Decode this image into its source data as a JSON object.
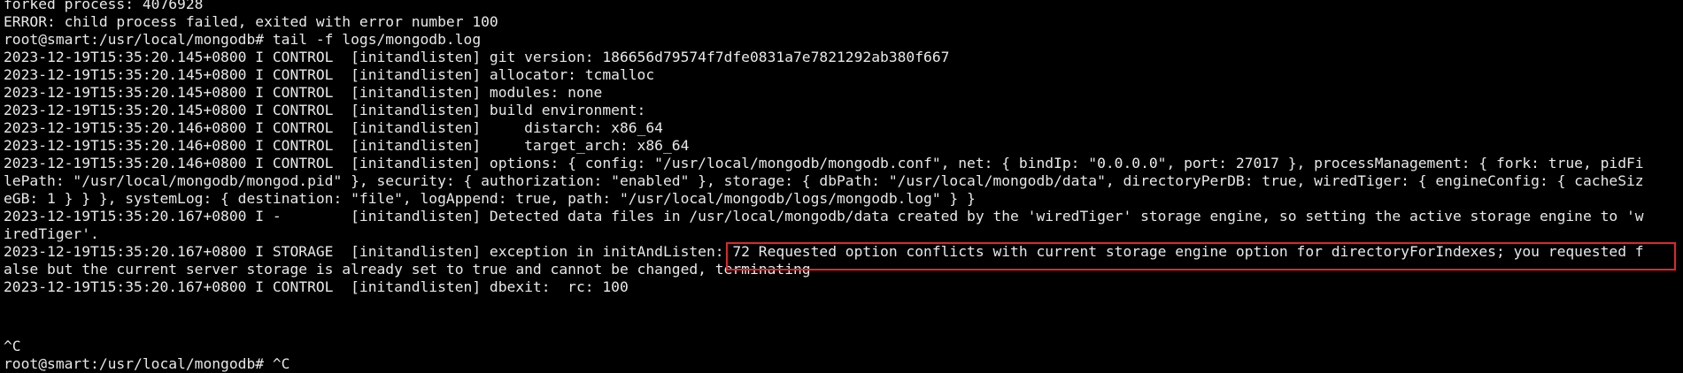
{
  "terminal": {
    "lines": [
      "forked process: 4076928",
      "ERROR: child process failed, exited with error number 100",
      "root@smart:/usr/local/mongodb# tail -f logs/mongodb.log",
      "2023-12-19T15:35:20.145+0800 I CONTROL  [initandlisten] git version: 186656d79574f7dfe0831a7e7821292ab380f667",
      "2023-12-19T15:35:20.145+0800 I CONTROL  [initandlisten] allocator: tcmalloc",
      "2023-12-19T15:35:20.145+0800 I CONTROL  [initandlisten] modules: none",
      "2023-12-19T15:35:20.145+0800 I CONTROL  [initandlisten] build environment:",
      "2023-12-19T15:35:20.146+0800 I CONTROL  [initandlisten]     distarch: x86_64",
      "2023-12-19T15:35:20.146+0800 I CONTROL  [initandlisten]     target_arch: x86_64",
      "2023-12-19T15:35:20.146+0800 I CONTROL  [initandlisten] options: { config: \"/usr/local/mongodb/mongodb.conf\", net: { bindIp: \"0.0.0.0\", port: 27017 }, processManagement: { fork: true, pidFi",
      "lePath: \"/usr/local/mongodb/mongod.pid\" }, security: { authorization: \"enabled\" }, storage: { dbPath: \"/usr/local/mongodb/data\", directoryPerDB: true, wiredTiger: { engineConfig: { cacheSiz",
      "eGB: 1 } } }, systemLog: { destination: \"file\", logAppend: true, path: \"/usr/local/mongodb/logs/mongodb.log\" } }",
      "2023-12-19T15:35:20.167+0800 I -        [initandlisten] Detected data files in /usr/local/mongodb/data created by the 'wiredTiger' storage engine, so setting the active storage engine to 'w",
      "iredTiger'.",
      "2023-12-19T15:35:20.167+0800 I STORAGE  [initandlisten] exception in initAndListen: 72 Requested option conflicts with current storage engine option for directoryForIndexes; you requested f",
      "alse but the current server storage is already set to true and cannot be changed, terminating",
      "2023-12-19T15:35:20.167+0800 I CONTROL  [initandlisten] dbexit:  rc: 100",
      "",
      "",
      "^C",
      "root@smart:/usr/local/mongodb# ^C"
    ]
  },
  "colors": {
    "background": "#000000",
    "text": "#e8e8e8",
    "highlight_border": "#e0262b"
  }
}
